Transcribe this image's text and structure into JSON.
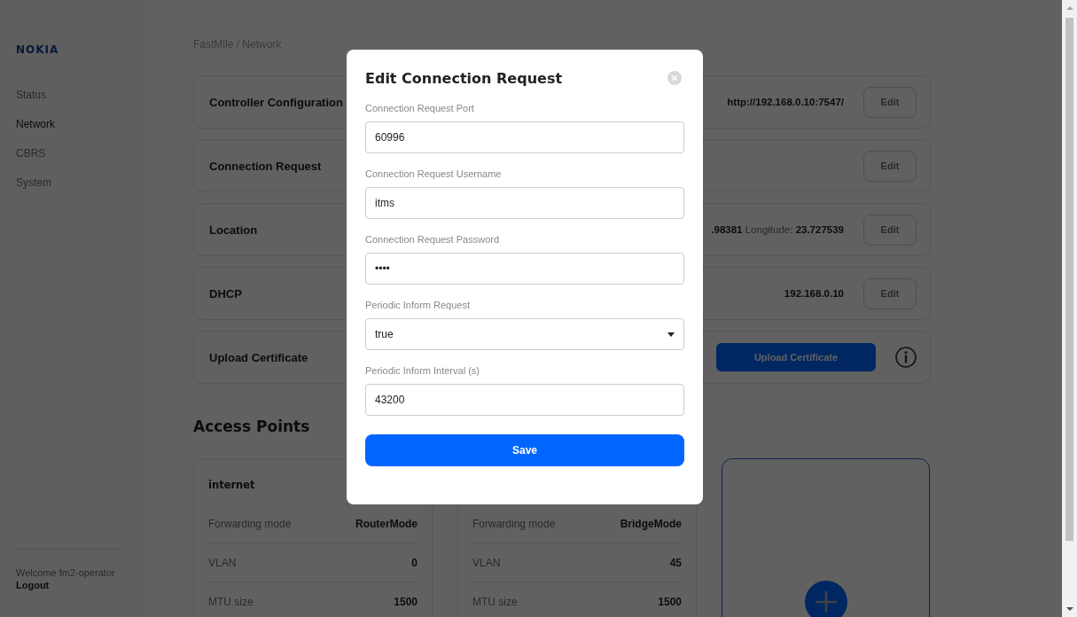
{
  "sidebar": {
    "logo": "NOKIA",
    "items": [
      {
        "label": "Status",
        "selected": false
      },
      {
        "label": "Network",
        "selected": true
      },
      {
        "label": "CBRS",
        "selected": false
      },
      {
        "label": "System",
        "selected": false
      }
    ],
    "welcome": "Welcome fm2-operator",
    "logout": "Logout"
  },
  "breadcrumb": "FastMile / Network",
  "settings": [
    {
      "kind": "edit",
      "title": "Controller Configuration",
      "value": "http://192.168.0.10:7547/",
      "button": "Edit"
    },
    {
      "kind": "edit",
      "title": "Connection Request",
      "button": "Edit"
    },
    {
      "kind": "edit",
      "title": "Location",
      "value": "**.98381** Longitude: **23.727539**",
      "button": "Edit"
    },
    {
      "kind": "edit",
      "title": "DHCP",
      "value": "192.168.0.10",
      "button": "Edit"
    },
    {
      "kind": "upload",
      "title": "Upload Certificate",
      "button": "Upload Certificate"
    }
  ],
  "access_points": {
    "title": "Access Points",
    "cards": [
      {
        "name": "internet",
        "rows": [
          {
            "label": "Forwarding mode",
            "value": "RouterMode"
          },
          {
            "label": "VLAN",
            "value": "0"
          },
          {
            "label": "MTU size",
            "value": "1500"
          }
        ]
      },
      {
        "rows": [
          {
            "label": "Forwarding mode",
            "value": "BridgeMode"
          },
          {
            "label": "VLAN",
            "value": "45"
          },
          {
            "label": "MTU size",
            "value": "1500"
          }
        ]
      }
    ]
  },
  "dialog": {
    "title": "Edit Connection Request",
    "fields": [
      {
        "kind": "text",
        "label": "Connection Request Port",
        "value": "60996"
      },
      {
        "kind": "text",
        "label": "Connection Request Username",
        "value": "itms"
      },
      {
        "kind": "text",
        "label": "Connection Request Password",
        "value": "••••"
      },
      {
        "kind": "select",
        "label": "Periodic Inform Request",
        "value": "true"
      },
      {
        "kind": "text",
        "label": "Periodic Inform Interval (s)",
        "value": "43200"
      }
    ],
    "save": "Save"
  }
}
